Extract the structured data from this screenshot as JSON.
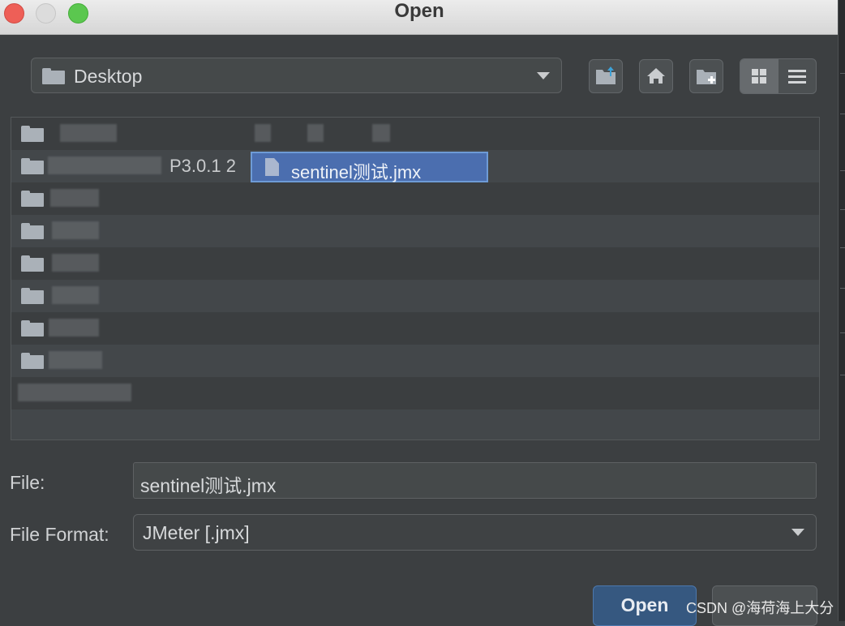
{
  "window": {
    "title": "Open"
  },
  "path_combo": {
    "value": "Desktop"
  },
  "toolbar": {
    "icons": [
      "folder-up-icon",
      "home-icon",
      "new-folder-icon",
      "grid-view-icon",
      "list-view-icon"
    ]
  },
  "file_list": {
    "rows": [
      {
        "label": ""
      },
      {
        "label": "P3.0.1 2"
      },
      {
        "label": ""
      },
      {
        "label": ""
      },
      {
        "label": ""
      },
      {
        "label": ""
      },
      {
        "label": ""
      },
      {
        "label": ""
      },
      {
        "label": ""
      }
    ],
    "selected_file": "sentinel测试.jmx"
  },
  "form": {
    "file_label": "File:",
    "file_value": "sentinel测试.jmx",
    "format_label": "File Format:",
    "format_value": "JMeter [.jmx]"
  },
  "buttons": {
    "open": "Open"
  },
  "watermark": "CSDN @海荷海上大分",
  "colors": {
    "background": "#3c3f41",
    "selection": "#4b6eaf",
    "primary_button": "#365880"
  }
}
